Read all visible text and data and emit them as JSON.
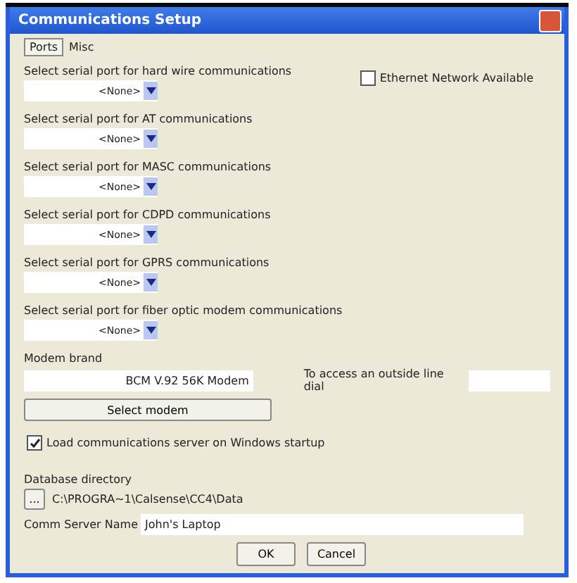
{
  "window": {
    "title": "Communications Setup"
  },
  "tabs": [
    {
      "label": "Ports",
      "selected": true
    },
    {
      "label": "Misc",
      "selected": false
    }
  ],
  "ethernet": {
    "label": "Ethernet Network Available",
    "checked": false
  },
  "ports": [
    {
      "label": "Select serial port for hard wire communications",
      "value": "<None>"
    },
    {
      "label": "Select serial port for AT communications",
      "value": "<None>"
    },
    {
      "label": "Select serial port for MASC communications",
      "value": "<None>"
    },
    {
      "label": "Select serial port for CDPD communications",
      "value": "<None>"
    },
    {
      "label": "Select serial port for GPRS communications",
      "value": "<None>"
    },
    {
      "label": "Select serial port for fiber optic modem communications",
      "value": "<None>"
    }
  ],
  "modem": {
    "label": "Modem brand",
    "value": "BCM V.92 56K Modem",
    "button": "Select modem",
    "dial_label": "To access an outside line dial"
  },
  "startup": {
    "label": "Load communications server on Windows startup",
    "checked": true
  },
  "database": {
    "label": "Database directory",
    "browse": "...",
    "path": "C:\\PROGRA~1\\Calsense\\CC4\\Data"
  },
  "server": {
    "label": "Comm Server Name",
    "value": "John's Laptop"
  },
  "buttons": [
    "OK",
    "Cancel"
  ]
}
